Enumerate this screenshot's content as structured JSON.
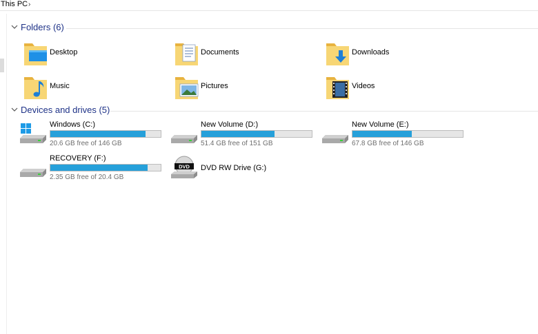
{
  "breadcrumb": {
    "location": "This PC",
    "separator": "›"
  },
  "groups": {
    "folders": {
      "title": "Folders (6)"
    },
    "drives": {
      "title": "Devices and drives (5)"
    }
  },
  "folders": [
    {
      "label": "Desktop",
      "icon": "desktop-folder-icon"
    },
    {
      "label": "Documents",
      "icon": "documents-folder-icon"
    },
    {
      "label": "Downloads",
      "icon": "downloads-folder-icon"
    },
    {
      "label": "Music",
      "icon": "music-folder-icon"
    },
    {
      "label": "Pictures",
      "icon": "pictures-folder-icon"
    },
    {
      "label": "Videos",
      "icon": "videos-folder-icon"
    }
  ],
  "drives": [
    {
      "name": "Windows (C:)",
      "free_text": "20.6 GB free of 146 GB",
      "used_fraction": 0.86,
      "icon": "windows-drive-icon"
    },
    {
      "name": "New Volume (D:)",
      "free_text": "51.4 GB free of 151 GB",
      "used_fraction": 0.66,
      "icon": "hard-drive-icon"
    },
    {
      "name": "New Volume (E:)",
      "free_text": "67.8 GB free of 146 GB",
      "used_fraction": 0.54,
      "icon": "hard-drive-icon"
    },
    {
      "name": "RECOVERY (F:)",
      "free_text": "2.35 GB free of 20.4 GB",
      "used_fraction": 0.88,
      "icon": "hard-drive-icon"
    },
    {
      "name": "DVD RW Drive (G:)",
      "icon": "dvd-drive-icon",
      "badge": "DVD"
    }
  ],
  "colors": {
    "accent": "#26a0da",
    "header_text": "#1e3287",
    "folder": "#f3c94f"
  }
}
